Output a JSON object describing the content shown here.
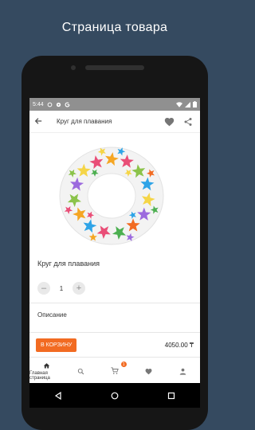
{
  "headline": "Страница товара",
  "status": {
    "time": "5:44"
  },
  "appbar": {
    "title": "Круг для плавания",
    "back_icon": "arrow-back-icon",
    "favorite_icon": "heart-icon",
    "share_icon": "share-icon"
  },
  "product": {
    "name": "Круг для плавания",
    "quantity": "1",
    "minus": "–",
    "plus": "+",
    "description_label": "Описание"
  },
  "buy": {
    "button_label": "В КОРЗИНУ",
    "price": "4050.00 ₸"
  },
  "nav": {
    "home_label": "Главная страница",
    "cart_badge": "1"
  },
  "colors": {
    "accent": "#f26b22",
    "background": "#354a60"
  }
}
